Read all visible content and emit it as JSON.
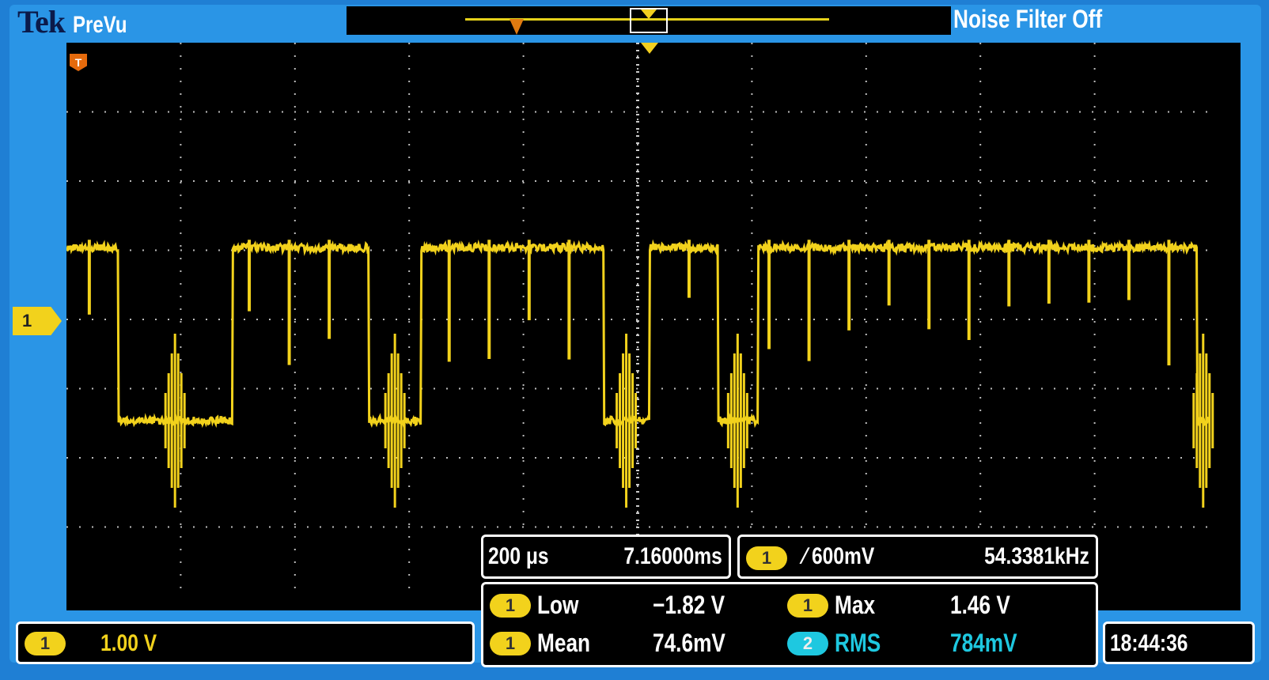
{
  "brand": {
    "maker": "Tek",
    "mode": "PreVu"
  },
  "status": {
    "noise_filter": "Noise Filter Off"
  },
  "channel1": {
    "marker": "1",
    "vertical_scale": "1.00 V"
  },
  "horizontal": {
    "timebase": "200 μs",
    "position": "7.16000ms"
  },
  "trigger": {
    "channel": "1",
    "slope": "rising",
    "level": "∕ 600mV",
    "frequency": "54.3381kHz"
  },
  "trigger_badge": "T",
  "measurements": [
    {
      "channel": "1",
      "label": "Low",
      "value": "−1.82 V",
      "color": "#f2d21c"
    },
    {
      "channel": "1",
      "label": "Max",
      "value": "1.46 V",
      "color": "#f2d21c"
    },
    {
      "channel": "1",
      "label": "Mean",
      "value": "74.6mV",
      "color": "#f2d21c"
    },
    {
      "channel": "2",
      "label": "RMS",
      "value": "784mV",
      "color": "#1ec8e0"
    }
  ],
  "clock": "18:44:36",
  "colors": {
    "trace_ch1": "#f2d21c",
    "trace_ch2": "#1ec8e0",
    "bezel": "#2a95e6",
    "trigger_marker": "#e56a0c"
  },
  "waveform": {
    "volts_per_div": 1.0,
    "high_level_v": 0.9,
    "low_level_v": -1.6,
    "low_segments_div": [
      [
        0.45,
        1.45
      ],
      [
        2.65,
        3.1
      ],
      [
        4.7,
        5.1
      ],
      [
        5.7,
        6.05
      ],
      [
        9.9,
        10.0
      ]
    ]
  }
}
